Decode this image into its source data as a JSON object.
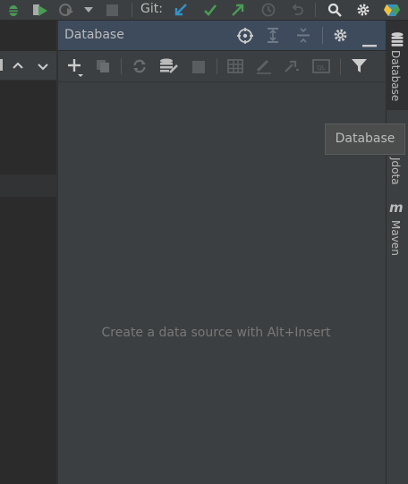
{
  "toolbar": {
    "git_label": "Git:",
    "icons": [
      "debug-icon",
      "run-coverage-icon",
      "profile-icon",
      "dropdown-icon",
      "stop-icon",
      "vcs-update-icon",
      "vcs-commit-icon",
      "vcs-push-icon",
      "history-icon",
      "rollback-icon",
      "search-icon",
      "settings-icon",
      "toolbox-icon"
    ]
  },
  "database_panel": {
    "title": "Database",
    "header_icons": [
      "locate-icon",
      "expand-all-icon",
      "collapse-all-icon",
      "settings-icon",
      "hide-icon"
    ],
    "toolbar_icons": [
      "add-icon",
      "duplicate-icon",
      "refresh-icon",
      "db-properties-icon",
      "stop-icon",
      "table-editor-icon",
      "edit-icon",
      "jump-icon",
      "query-console-icon",
      "filter-icon"
    ],
    "empty_text": "Create a data source with Alt+Insert"
  },
  "right_strip": {
    "tabs": [
      {
        "label": "Database",
        "icon": "database-icon"
      },
      {
        "label": "Jdota",
        "icon": ""
      },
      {
        "label": "Maven",
        "icon": "maven-icon"
      }
    ]
  },
  "tooltip": {
    "text": "Database"
  },
  "colors": {
    "panel_bg": "#3c3f41",
    "header_bg": "#3d4b5c",
    "editor_bg": "#2b2b2b",
    "git_blue": "#3592c4",
    "git_green": "#499c54"
  }
}
